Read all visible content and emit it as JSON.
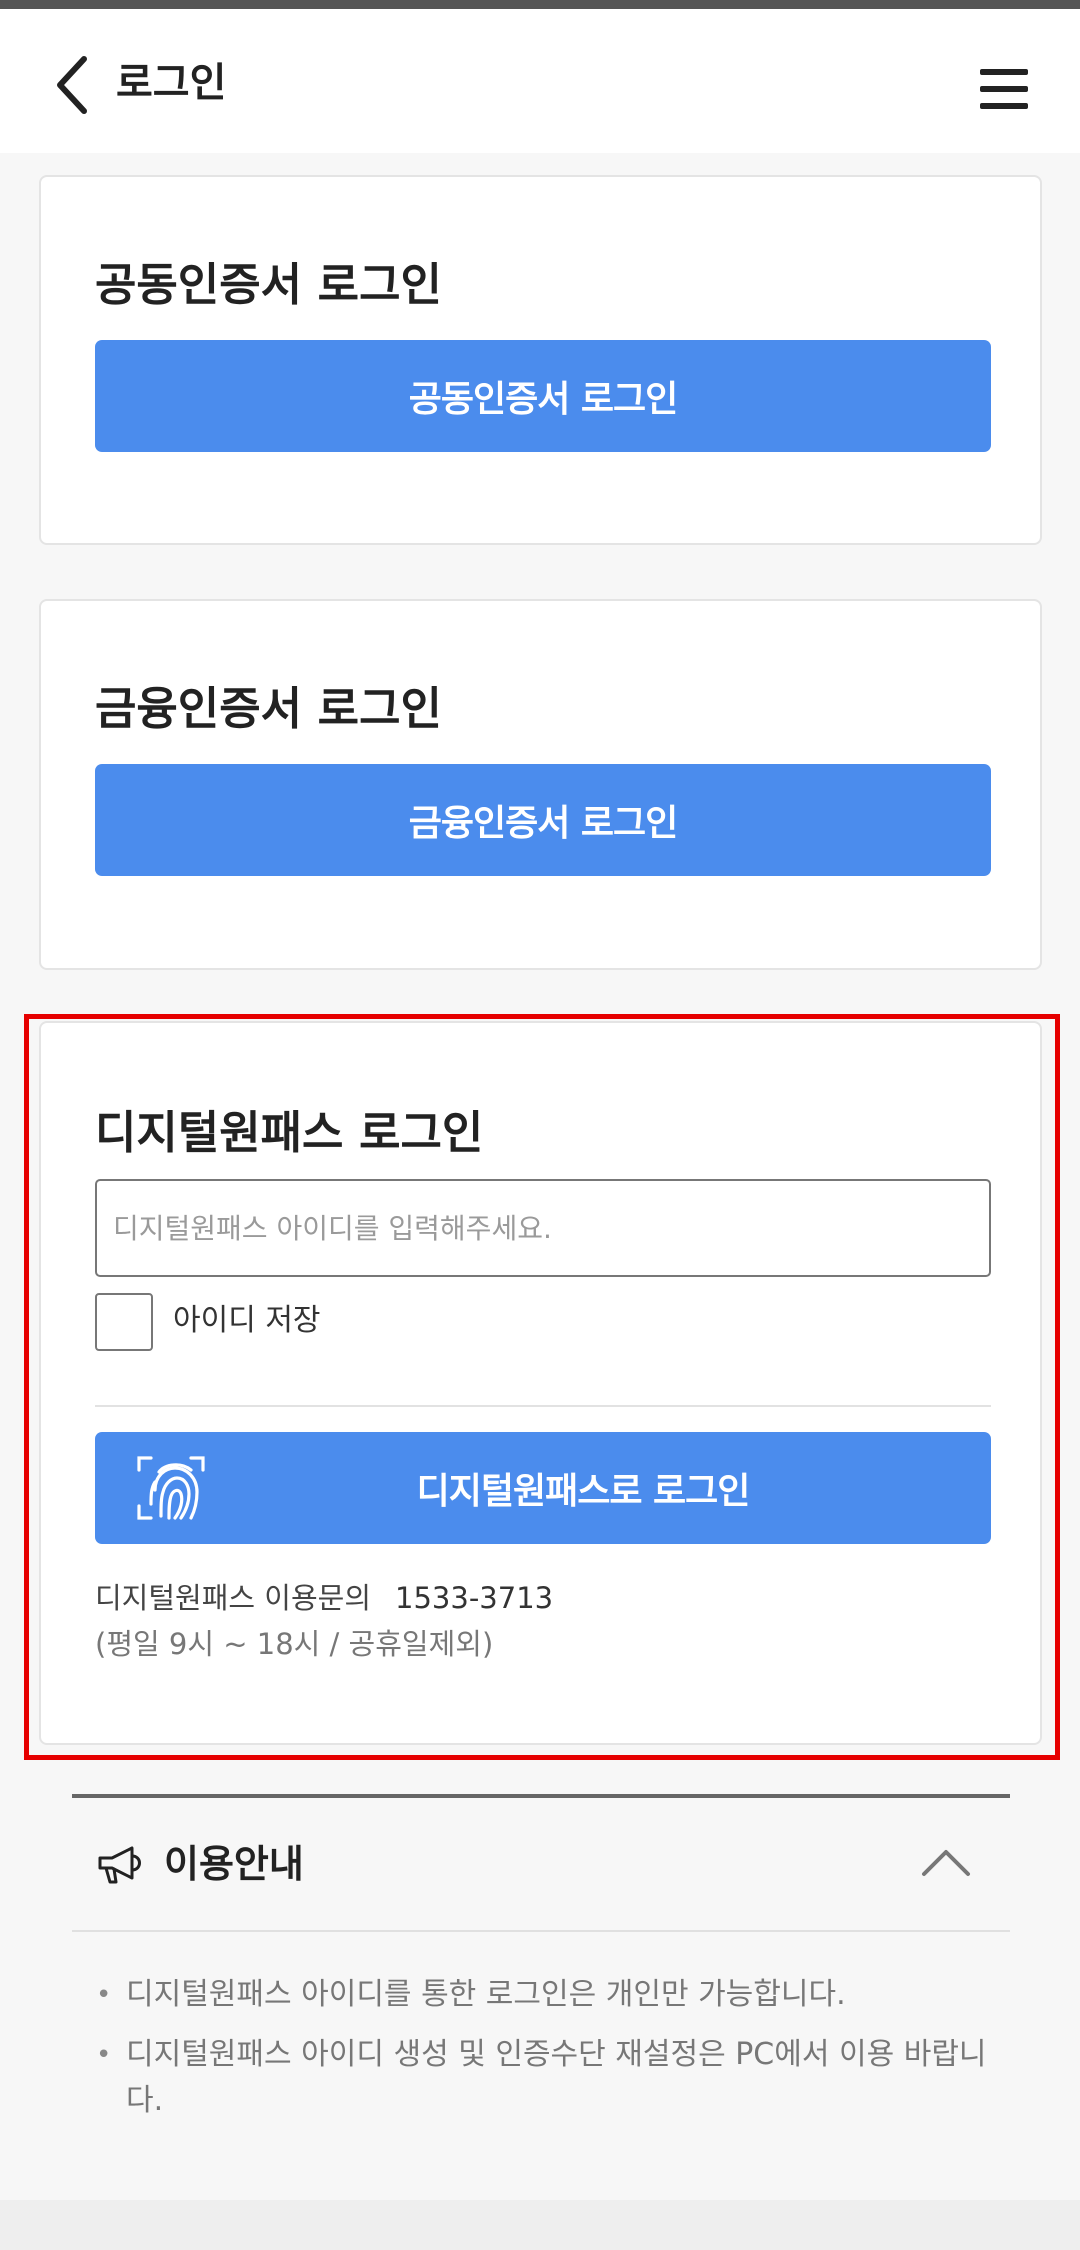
{
  "header": {
    "title": "로그인"
  },
  "cards": {
    "joint_cert": {
      "title": "공동인증서 로그인",
      "button_label": "공동인증서 로그인"
    },
    "financial_cert": {
      "title": "금융인증서 로그인",
      "button_label": "금융인증서 로그인"
    },
    "digital_onepass": {
      "title": "디지털원패스 로그인",
      "input_placeholder": "디지털원패스 아이디를 입력해주세요.",
      "input_value": "",
      "save_id_label": "아이디 저장",
      "save_id_checked": false,
      "login_button_label": "디지털원패스로 로그인",
      "inquiry_label": "디지털원패스 이용문의",
      "inquiry_phone": "1533-3713",
      "hours_note": "(평일 9시 ~ 18시 / 공휴일제외)"
    }
  },
  "guide": {
    "title": "이용안내",
    "items": [
      "디지털원패스 아이디를 통한 로그인은 개인만 가능합니다.",
      "디지털원패스 아이디 생성 및 인증수단 재설정은 PC에서 이용 바랍니다."
    ]
  },
  "colors": {
    "primary_button": "#4b8ced",
    "highlight_border": "#e60000"
  }
}
